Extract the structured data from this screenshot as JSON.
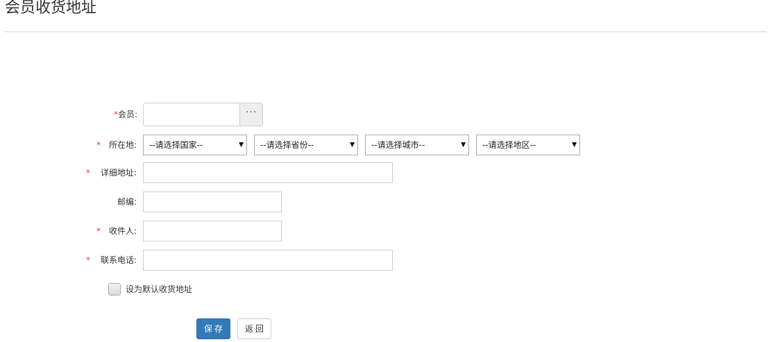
{
  "page": {
    "title": "会员收货地址"
  },
  "form": {
    "required_mark": "*",
    "member": {
      "label": "会员:",
      "value": "",
      "picker_label": "···"
    },
    "location": {
      "label": "所在地:",
      "country": "--请选择国家--",
      "province": "--请选择省份--",
      "city": "--请选择城市--",
      "district": "--请选择地区--"
    },
    "address": {
      "label": "详细地址:",
      "value": ""
    },
    "postcode": {
      "label": "邮编:",
      "value": ""
    },
    "receiver": {
      "label": "收件人:",
      "value": ""
    },
    "phone": {
      "label": "联系电话:",
      "value": ""
    },
    "default_checkbox": {
      "label": "设为默认收货地址",
      "checked": false
    }
  },
  "actions": {
    "save_label": "保存",
    "back_label": "返回"
  },
  "icons": {
    "select_caret": "▼"
  }
}
